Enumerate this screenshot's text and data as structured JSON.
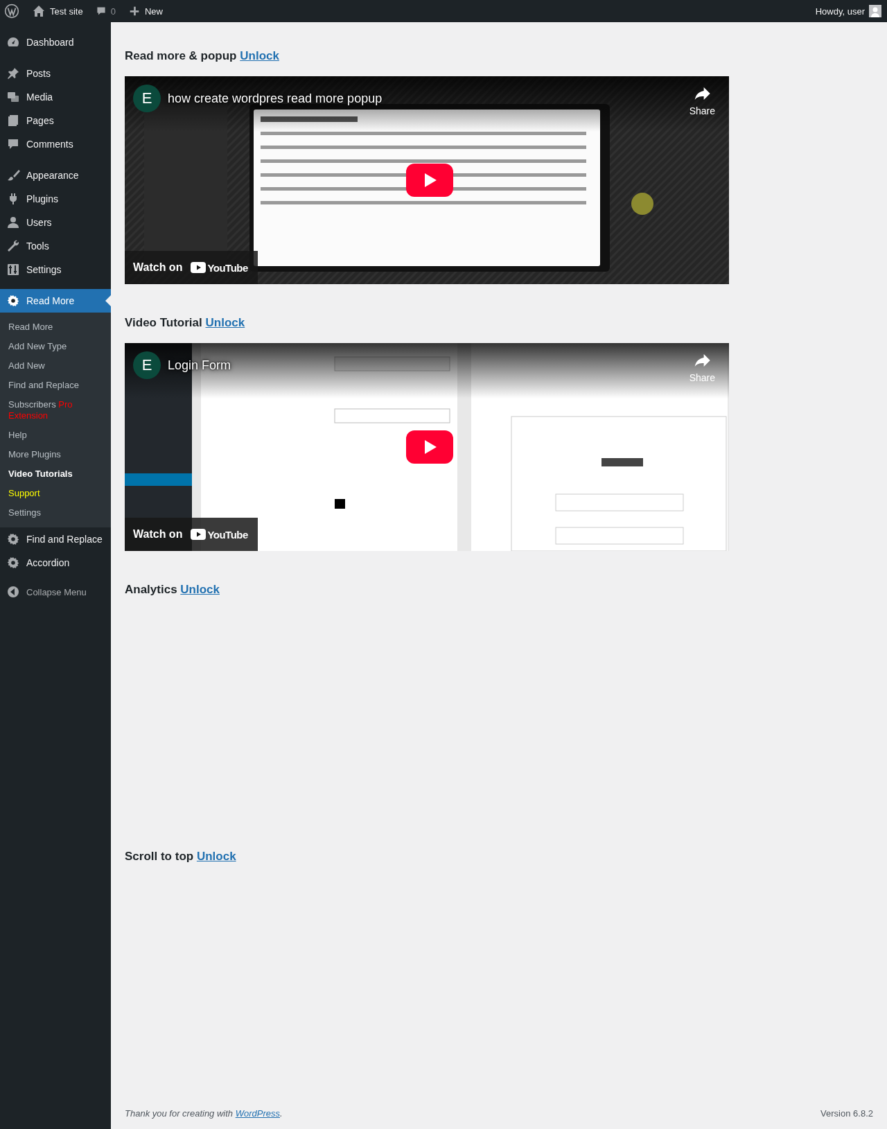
{
  "admin_bar": {
    "site": "Test site",
    "comments_count": "0",
    "new": "New",
    "greeting": "Howdy, user"
  },
  "sidebar": {
    "groups": [
      [
        {
          "label": "Dashboard",
          "selected": false
        }
      ],
      [
        {
          "label": "Posts",
          "selected": false
        },
        {
          "label": "Media",
          "selected": false
        },
        {
          "label": "Pages",
          "selected": false
        },
        {
          "label": "Comments",
          "selected": false
        }
      ],
      [
        {
          "label": "Appearance",
          "selected": false
        },
        {
          "label": "Plugins",
          "selected": false
        },
        {
          "label": "Users",
          "selected": false
        },
        {
          "label": "Tools",
          "selected": false
        },
        {
          "label": "Settings",
          "selected": false
        }
      ],
      [
        {
          "label": "Read More",
          "selected": true,
          "expanded": true,
          "children": [
            {
              "label": "Read More",
              "selected": false
            },
            {
              "label": "Add New Type",
              "selected": false
            },
            {
              "label": "Add New",
              "selected": false
            },
            {
              "label": "Find and Replace",
              "selected": false
            },
            {
              "label": "Subscribers",
              "extra": "Pro Extension",
              "selected": false
            },
            {
              "label": "Help",
              "selected": false
            },
            {
              "label": "More Plugins",
              "selected": false
            },
            {
              "label": "Video Tutorials",
              "selected": true
            },
            {
              "label": "Support",
              "selected": false,
              "color": "#ffff00"
            },
            {
              "label": "Settings",
              "selected": false
            }
          ]
        },
        {
          "label": "Find and Replace",
          "selected": false
        },
        {
          "label": "Accordion",
          "selected": false
        }
      ]
    ],
    "collapse": "Collapse Menu"
  },
  "sections": [
    {
      "title": "Read more & popup",
      "link": "Unlock",
      "video": {
        "kind": "picture",
        "channel": "E",
        "title": "how create wordpres read more popup",
        "share": "Share",
        "watch_on": "Watch on",
        "brand": "YouTube"
      }
    },
    {
      "title": "Video Tutorial",
      "link": "Unlock",
      "video": {
        "kind": "picture",
        "channel": "E",
        "title": "Login Form",
        "share": "Share",
        "watch_on": "Watch on",
        "brand": "YouTube"
      }
    },
    {
      "title": "Analytics",
      "link": "Unlock"
    },
    {
      "title": "Scroll to top",
      "link": "Unlock"
    }
  ],
  "footer": {
    "text": "Thank you for creating with",
    "link": "WordPress",
    "suffix": ".",
    "version": "Version 6.8.2"
  }
}
